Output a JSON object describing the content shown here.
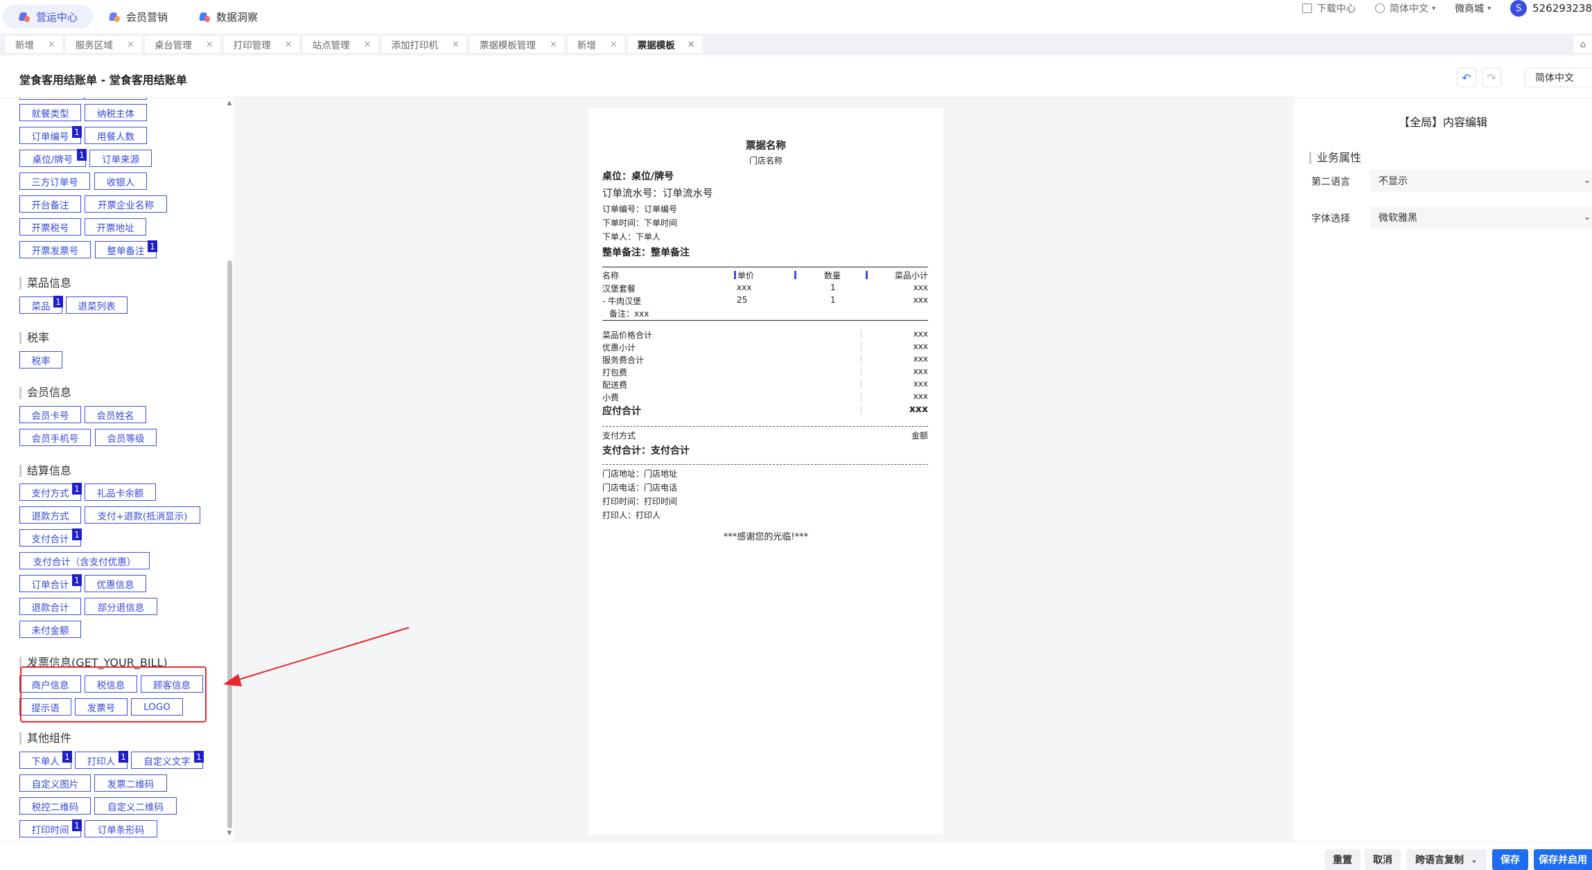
{
  "topbar": {
    "apps": [
      {
        "label": "营运中心",
        "active": true
      },
      {
        "label": "会员营销",
        "active": false
      },
      {
        "label": "数据洞察",
        "active": false
      }
    ],
    "download": "下载中心",
    "language": "简体中文",
    "shop": "微商城",
    "avatar_letter": "S",
    "user_id": "526293238"
  },
  "tabs": [
    {
      "label": "新增",
      "active": false
    },
    {
      "label": "服务区域",
      "active": false
    },
    {
      "label": "桌台管理",
      "active": false
    },
    {
      "label": "打印管理",
      "active": false
    },
    {
      "label": "站点管理",
      "active": false
    },
    {
      "label": "添加打印机",
      "active": false
    },
    {
      "label": "票据模板管理",
      "active": false
    },
    {
      "label": "新增",
      "active": false
    },
    {
      "label": "票据模板",
      "active": true
    }
  ],
  "tab_close": "×",
  "header": {
    "title": "堂食客用结账单 - 堂食客用结账单",
    "undo": "↶",
    "redo": "↷",
    "language": "简体中文"
  },
  "left": {
    "sections": {
      "dish": "菜品信息",
      "tax": "税率",
      "member": "会员信息",
      "settle": "结算信息",
      "invoice": "发票信息(GET_YOUR_BILL)",
      "other": "其他组件"
    },
    "fields": {
      "dining_type": "就餐类型",
      "tax_entity": "纳税主体",
      "order_no": "订单编号",
      "diners": "用餐人数",
      "table_no": "桌位/牌号",
      "order_source": "订单来源",
      "third_order": "三方订单号",
      "cashier": "收银人",
      "open_remark": "开台备注",
      "invoice_company": "开票企业名称",
      "invoice_tax_no": "开票税号",
      "invoice_addr": "开票地址",
      "invoice_no": "开票发票号",
      "order_remark": "整单备注",
      "dish": "菜品",
      "refund_list": "退菜列表",
      "tax_rate": "税率",
      "member_card": "会员卡号",
      "member_name": "会员姓名",
      "member_phone": "会员手机号",
      "member_level": "会员等级",
      "pay_method": "支付方式",
      "gift_balance": "礼品卡余额",
      "refund_method": "退款方式",
      "pay_refund": "支付+退款(抵消显示)",
      "pay_total": "支付合计",
      "pay_total_disc": "支付合计（含支付优惠）",
      "order_total": "订单合计",
      "discount_info": "优惠信息",
      "refund_total": "退款合计",
      "partial_refund": "部分退信息",
      "unpaid": "未付金额",
      "merchant_info": "商户信息",
      "tax_info": "税信息",
      "customer_info": "顾客信息",
      "tip": "提示语",
      "invoice_num": "发票号",
      "logo": "LOGO",
      "orderer": "下单人",
      "printer_person": "打印人",
      "custom_text": "自定义文字",
      "custom_image": "自定义图片",
      "invoice_qr": "发票二维码",
      "tax_qr": "税控二维码",
      "custom_qr": "自定义二维码",
      "print_time": "打印时间",
      "order_barcode": "订单条形码"
    },
    "badge": "1"
  },
  "receipt": {
    "name": "票据名称",
    "store": "门店名称",
    "table": "桌位：桌位/牌号",
    "serial": "订单流水号：订单流水号",
    "order_no": "订单编号：订单编号",
    "order_time": "下单时间：下单时间",
    "orderer": "下单人：下单人",
    "remark": "整单备注：整单备注",
    "cols": {
      "name": "名称",
      "price": "单价",
      "qty": "数量",
      "subtotal": "菜品小计"
    },
    "items": [
      {
        "name": "汉堡套餐",
        "price": "xxx",
        "qty": "1",
        "subtotal": "xxx"
      },
      {
        "name": "- 牛肉汉堡",
        "price": "25",
        "qty": "1",
        "subtotal": "xxx"
      }
    ],
    "item_note": "备注：xxx",
    "summary": [
      {
        "label": "菜品价格合计",
        "value": "xxx"
      },
      {
        "label": "优惠小计",
        "value": "xxx"
      },
      {
        "label": "服务费合计",
        "value": "xxx"
      },
      {
        "label": "打包费",
        "value": "xxx"
      },
      {
        "label": "配送费",
        "value": "xxx"
      },
      {
        "label": "小费",
        "value": "xxx"
      }
    ],
    "payable_label": "应付合计",
    "payable_value": "xxx",
    "pay_method": "支付方式",
    "amount": "金额",
    "pay_total": "支付合计：支付合计",
    "store_addr": "门店地址：门店地址",
    "store_phone": "门店电话：门店电话",
    "print_time": "打印时间：打印时间",
    "printer": "打印人：打印人",
    "thanks": "***感谢您的光临!***"
  },
  "right": {
    "title": "【全局】内容编辑",
    "section": "业务属性",
    "second_lang_label": "第二语言",
    "second_lang_value": "不显示",
    "font_label": "字体选择",
    "font_value": "微软雅黑"
  },
  "bottom": {
    "reset": "重置",
    "cancel": "取消",
    "copy": "跨语言复制",
    "save": "保存",
    "save_enable": "保存并启用"
  },
  "colors": {
    "accent": "#3c4fd8",
    "field_border": "#3d4fe0",
    "badge": "#1e1fc8",
    "primary_button": "#1e6cf0",
    "annotation": "#e8262b"
  }
}
